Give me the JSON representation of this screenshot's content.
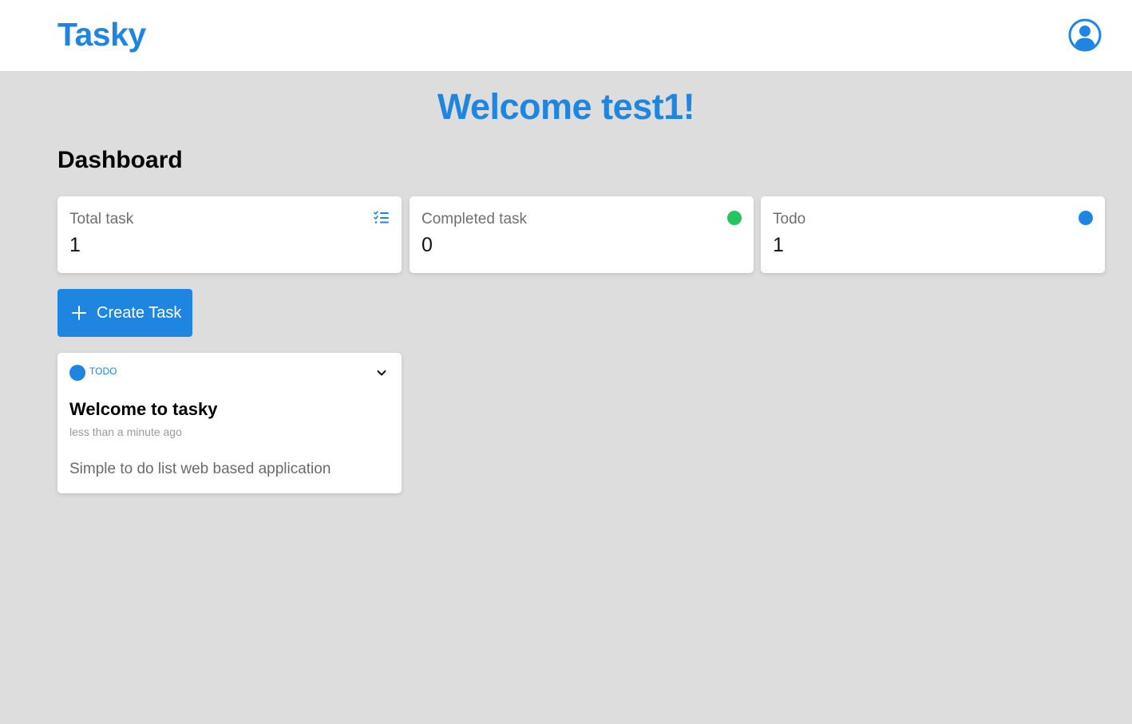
{
  "header": {
    "brand": "Tasky",
    "avatar_icon": "user-circle-icon"
  },
  "welcome": "Welcome test1!",
  "dashboard": {
    "title": "Dashboard",
    "cards": [
      {
        "label": "Total task",
        "value": "1",
        "icon": "checklist-icon",
        "color": "#1e86e0"
      },
      {
        "label": "Completed task",
        "value": "0",
        "icon": "green-dot",
        "color": "#22c55e"
      },
      {
        "label": "Todo",
        "value": "1",
        "icon": "blue-dot",
        "color": "#1e86e0"
      }
    ]
  },
  "create_button": {
    "label": "Create Task",
    "icon": "plus-icon"
  },
  "tasks": [
    {
      "status": "TODO",
      "status_color": "#1e86e0",
      "title": "Welcome to tasky",
      "time": "less than a minute ago",
      "description": "Simple to do list web based application",
      "toggle_icon": "chevron-down-icon"
    }
  ],
  "colors": {
    "primary": "#1e86e0",
    "background": "#dddddd",
    "success": "#22c55e"
  }
}
